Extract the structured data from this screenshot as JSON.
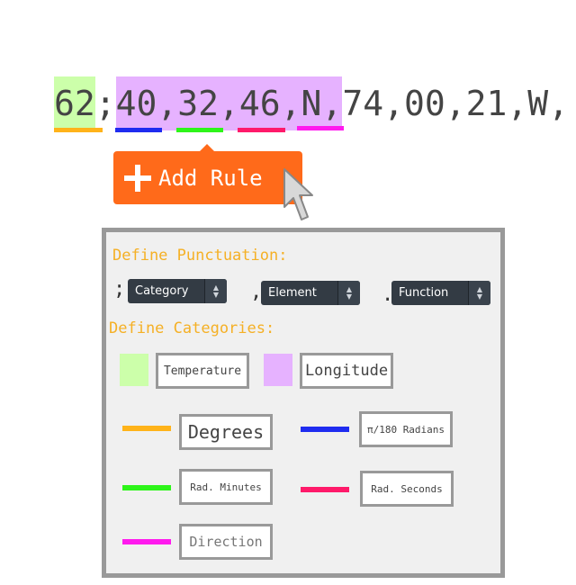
{
  "sequence": {
    "tokens": [
      {
        "text": "62",
        "highlight": "temperature"
      },
      {
        "text": ";",
        "highlight": null
      },
      {
        "text": "40,32,46,N,",
        "highlight": "longitude"
      },
      {
        "text": "74,00,21,W,",
        "highlight": null
      }
    ],
    "underline_colors": [
      "#ffb31a",
      "#1f2cf0",
      "#2ef51a",
      "#ff1a6a",
      "#ff1aee"
    ]
  },
  "add_rule": {
    "label": "Add Rule"
  },
  "panel": {
    "punctuation_title": "Define Punctuation:",
    "punctuation": [
      {
        "char": ";",
        "selected": "Category"
      },
      {
        "char": ",",
        "selected": "Element"
      },
      {
        "char": ".",
        "selected": "Function"
      }
    ],
    "categories_title": "Define Categories:",
    "categories": [
      {
        "label": "Temperature",
        "color": "#ccffaa"
      },
      {
        "label": "Longitude",
        "color": "#e6b2ff"
      }
    ],
    "elements": [
      {
        "label": "Degrees",
        "color": "#ffb31a"
      },
      {
        "label": "π/180 Radians",
        "color": "#1f2cf0"
      },
      {
        "label": "Rad. Minutes",
        "color": "#2ef51a"
      },
      {
        "label": "Rad. Seconds",
        "color": "#ff1a6a"
      },
      {
        "label": "Direction",
        "color": "#ff1aee"
      }
    ]
  },
  "colors": {
    "accent_orange": "#ff6a1a",
    "title_yellow": "#f5b025",
    "panel_border": "#999999",
    "select_bg": "#333b44"
  }
}
